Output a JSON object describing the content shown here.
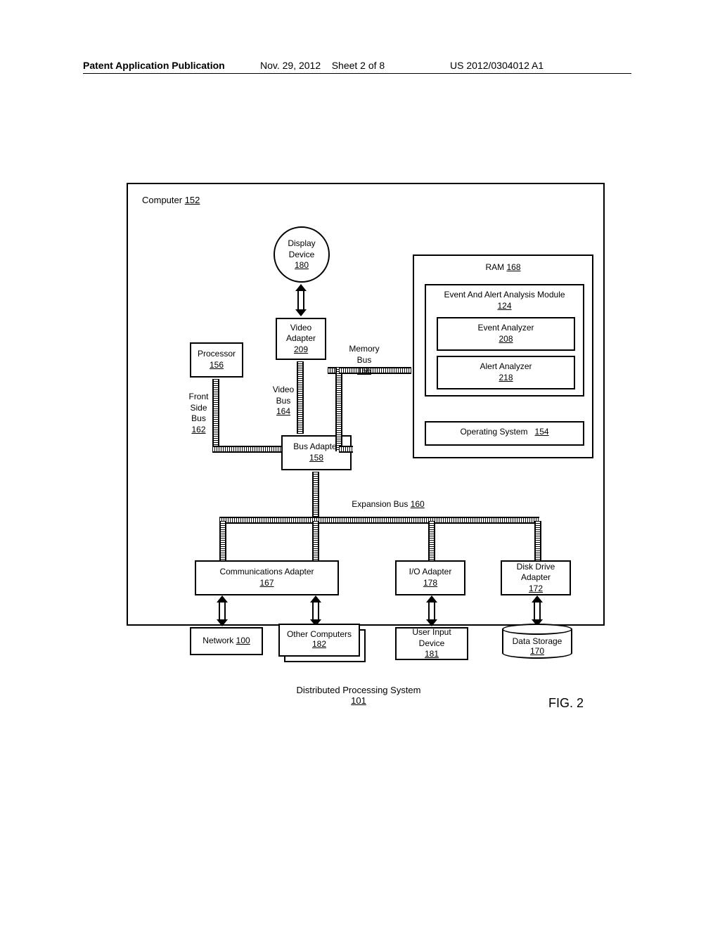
{
  "header": {
    "left": "Patent Application Publication",
    "date": "Nov. 29, 2012",
    "sheet": "Sheet 2 of 8",
    "pubnum": "US 2012/0304012 A1"
  },
  "computer": {
    "label": "Computer",
    "ref": "152"
  },
  "display_device": {
    "label": "Display Device",
    "ref": "180"
  },
  "video_adapter": {
    "label": "Video Adapter",
    "ref": "209"
  },
  "processor": {
    "label": "Processor",
    "ref": "156"
  },
  "bus_adapter": {
    "label": "Bus Adapter",
    "ref": "158"
  },
  "front_side_bus": {
    "label": "Front Side Bus",
    "ref": "162"
  },
  "video_bus": {
    "label": "Video Bus",
    "ref": "164"
  },
  "memory_bus": {
    "label": "Memory Bus",
    "ref": "166"
  },
  "expansion_bus": {
    "label": "Expansion Bus",
    "ref": "160"
  },
  "ram": {
    "label": "RAM",
    "ref": "168"
  },
  "eaa_module": {
    "label": "Event And Alert Analysis Module",
    "ref": "124"
  },
  "event_analyzer": {
    "label": "Event Analyzer",
    "ref": "208"
  },
  "alert_analyzer": {
    "label": "Alert Analyzer",
    "ref": "218"
  },
  "os": {
    "label": "Operating System",
    "ref": "154"
  },
  "comm_adapter": {
    "label": "Communications Adapter",
    "ref": "167"
  },
  "io_adapter": {
    "label": "I/O Adapter",
    "ref": "178"
  },
  "disk_adapter": {
    "label": "Disk Drive Adapter",
    "ref": "172"
  },
  "network": {
    "label": "Network",
    "ref": "100"
  },
  "other_computers": {
    "label": "Other Computers",
    "ref": "182"
  },
  "user_input": {
    "label": "User Input Device",
    "ref": "181"
  },
  "data_storage": {
    "label": "Data Storage",
    "ref": "170"
  },
  "dps": {
    "label": "Distributed Processing System",
    "ref": "101"
  },
  "figure": "FIG. 2"
}
